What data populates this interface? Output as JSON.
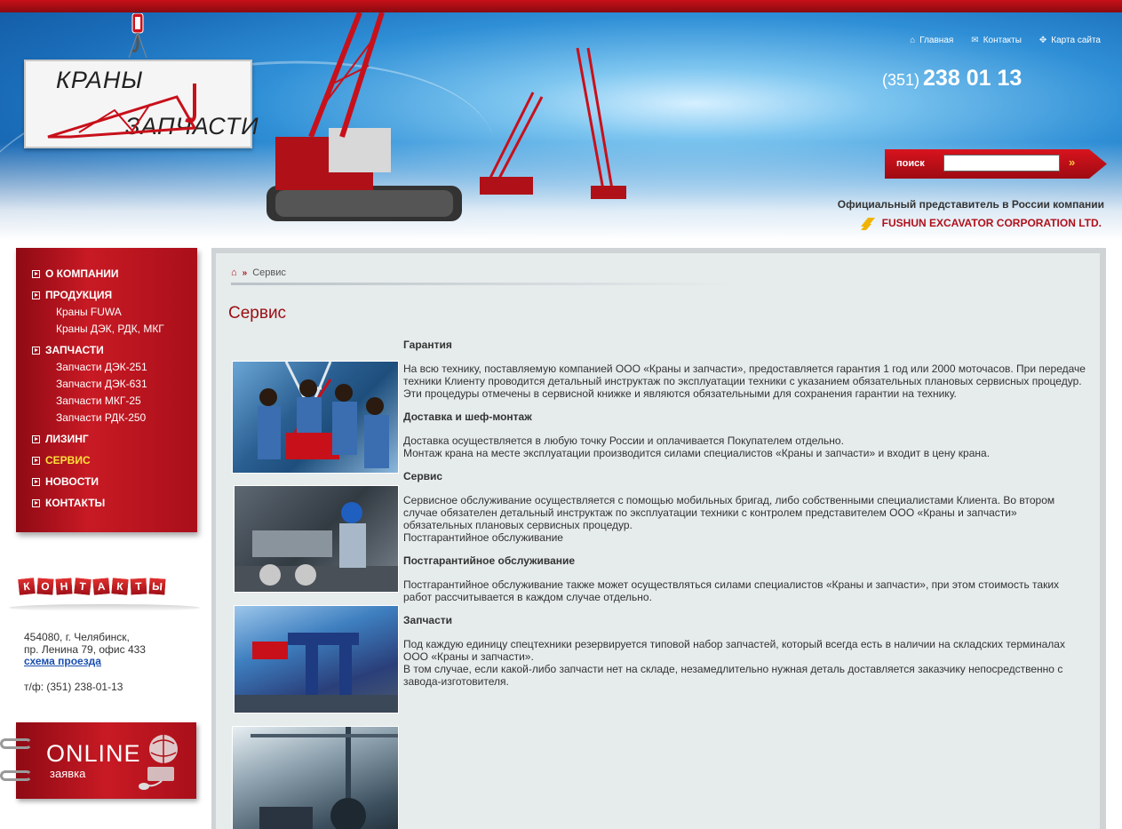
{
  "header": {
    "logo_line1": "КРАНЫ",
    "logo_line2": "ЗАПЧАСТИ",
    "top_links": [
      {
        "icon": "home-icon",
        "label": "Главная"
      },
      {
        "icon": "mail-icon",
        "label": "Контакты"
      },
      {
        "icon": "sitemap-icon",
        "label": "Карта сайта"
      }
    ],
    "phone_code": "(351)",
    "phone_number": "238 01 13",
    "search_label": "поиск",
    "search_value": "",
    "search_go": "»",
    "official_text": "Официальный представитель в России компании",
    "company_name": "FUSHUN EXCAVATOR CORPORATION LTD."
  },
  "nav": {
    "items": [
      {
        "label": "О КОМПАНИИ"
      },
      {
        "label": "ПРОДУКЦИЯ"
      },
      {
        "label": "ЗАПЧАСТИ"
      },
      {
        "label": "ЛИЗИНГ"
      },
      {
        "label": "СЕРВИС"
      },
      {
        "label": "НОВОСТИ"
      },
      {
        "label": "КОНТАКТЫ"
      }
    ],
    "products_sub": [
      "Краны FUWA",
      "Краны ДЭК, РДК, МКГ"
    ],
    "parts_sub": [
      "Запчасти ДЭК-251",
      "Запчасти ДЭК-631",
      "Запчасти МКГ-25",
      "Запчасти РДК-250"
    ],
    "active": "СЕРВИС"
  },
  "contacts": {
    "title_letters": [
      "К",
      "О",
      "Н",
      "Т",
      "А",
      "К",
      "Т",
      "Ы"
    ],
    "address_line1": "454080, г. Челябинск,",
    "address_line2": "пр. Ленина 79, офис 433",
    "map_link": "схема проезда",
    "phone": "т/ф: (351) 238-01-13"
  },
  "online": {
    "title": "ONLINE",
    "subtitle": "заявка"
  },
  "colors": {
    "brand_red": "#b0101a",
    "active_nav": "#ffe23a",
    "link_blue": "#1a4fb0"
  },
  "main": {
    "breadcrumb_current": "Сервис",
    "page_title": "Сервис",
    "sections": [
      {
        "heading": "Гарантия",
        "paragraphs": [
          "На всю технику, поставляемую компанией ООО «Краны и запчасти», предоставляется гарантия 1 год или 2000 моточасов. При передаче техники Клиенту проводится детальный инструктаж по эксплуатации техники с указанием обязательных плановых сервисных процедур. Эти процедуры отмечены в сервисной книжке и являются обязательными для сохранения гарантии на технику."
        ]
      },
      {
        "heading": "Доставка и шеф-монтаж",
        "paragraphs": [
          "Доставка осуществляется в любую точку России и оплачивается Покупателем отдельно.",
          "Монтаж крана на месте эксплуатации производится силами специалистов «Краны и запчасти» и входит в цену крана."
        ]
      },
      {
        "heading": "Сервис",
        "paragraphs": [
          "Сервисное обслуживание осуществляется с помощью мобильных бригад, либо собственными специалистами Клиента. Во втором случае обязателен детальный инструктаж по эксплуатации техники с контролем представителем ООО «Краны и запчасти» обязательных плановых сервисных процедур.",
          "Постгарантийное обслуживание"
        ]
      },
      {
        "heading": "Постгарантийное обслуживание",
        "paragraphs": [
          "Постгарантийное обслуживание также может осуществляться силами специалистов «Краны и запчасти», при этом стоимость таких работ рассчитывается в каждом случае отдельно."
        ]
      },
      {
        "heading": "Запчасти",
        "paragraphs": [
          "Под каждую единицу спецтехники резервируется типовой набор запчастей, который всегда есть в наличии на складских терминалах ООО «Краны и запчасти».",
          "В том случае, если какой-либо запчасти нет на складе, незамедлительно нужная деталь доставляется заказчику непосредственно с завода-изготовителя."
        ]
      }
    ]
  }
}
